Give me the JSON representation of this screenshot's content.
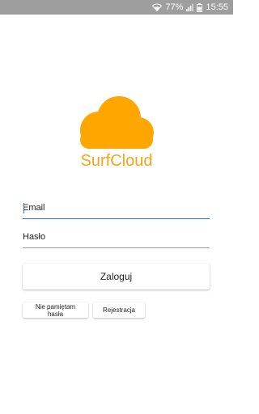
{
  "status_bar": {
    "battery_percent": "77%",
    "time": "15:55",
    "icons": [
      "wifi-icon",
      "signal-icon",
      "battery-icon"
    ]
  },
  "app": {
    "name": "SurfCloud",
    "brand_color": "#f5a418",
    "logo_icon": "cloud-icon"
  },
  "login_form": {
    "email_placeholder": "Email",
    "password_placeholder": "Hasło",
    "login_label": "Zaloguj",
    "forgot_label": "Nie pamiętam hasła",
    "register_label": "Rejestracja",
    "accent_color": "#1e7fd2"
  }
}
